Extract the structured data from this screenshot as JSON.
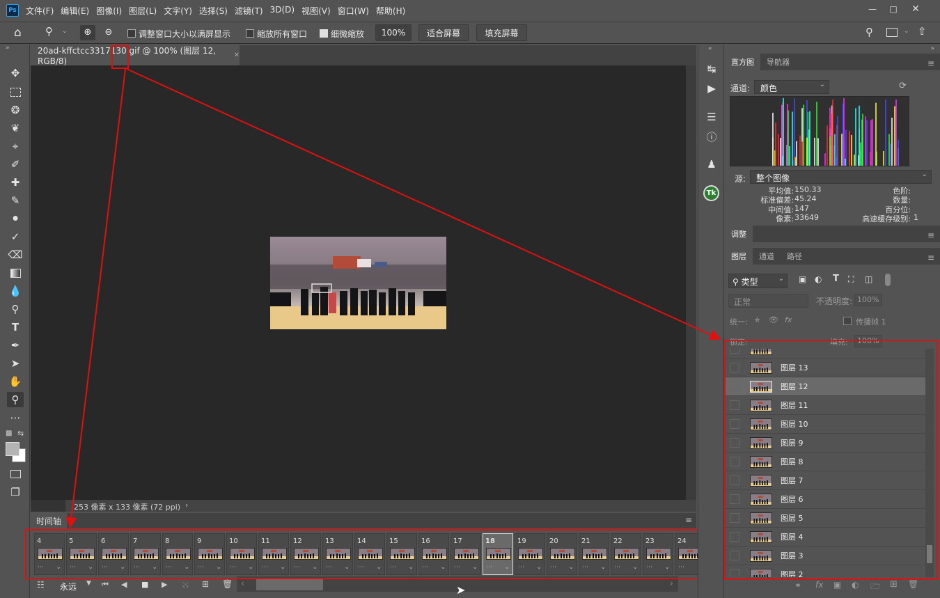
{
  "app": {
    "logo": "Ps",
    "menu": [
      "文件(F)",
      "编辑(E)",
      "图像(I)",
      "图层(L)",
      "文字(Y)",
      "选择(S)",
      "滤镜(T)",
      "3D(D)",
      "视图(V)",
      "窗口(W)",
      "帮助(H)"
    ]
  },
  "options": {
    "resize_windows": "调整窗口大小以满屏显示",
    "zoom_all": "缩放所有窗口",
    "scrubby_zoom": "细微缩放",
    "zoom_value": "100%",
    "fit_screen": "适合屏幕",
    "fill_screen": "填充屏幕"
  },
  "document": {
    "tab_title": "20ad-kffctcc3317130.gif @ 100% (图层 12, RGB/8)",
    "status": "253 像素 x 133 像素 (72 ppi)"
  },
  "timeline": {
    "title": "时间轴",
    "loop": "永远",
    "frames": [
      "4",
      "5",
      "6",
      "7",
      "8",
      "9",
      "10",
      "11",
      "12",
      "13",
      "14",
      "15",
      "16",
      "17",
      "18",
      "19",
      "20",
      "21",
      "22",
      "23",
      "24"
    ],
    "selected_frame": "18"
  },
  "histogram": {
    "tab": "直方图",
    "tab2": "导航器",
    "channel_label": "通道:",
    "channel": "颜色",
    "source_label": "源:",
    "source": "整个图像",
    "mean_label": "平均值:",
    "mean": "150.33",
    "std_label": "标准偏差:",
    "std": "45.24",
    "median_label": "中间值:",
    "median": "147",
    "pixels_label": "像素:",
    "pixels": "33649",
    "level_label": "色阶:",
    "count_label": "数量:",
    "percentile_label": "百分位:",
    "cache_label": "高速缓存级别:",
    "cache": "1"
  },
  "adjust": {
    "tab": "调整"
  },
  "layers_panel": {
    "tabs": [
      "图层",
      "通道",
      "路径"
    ],
    "filter": "类型",
    "blend": "正常",
    "opacity_label": "不透明度:",
    "opacity": "100%",
    "unify_label": "统一:",
    "propagate": "传播帧 1",
    "lock_label": "锁定:",
    "fill_label": "填充:",
    "fill": "100%",
    "layers": [
      "图层 13",
      "图层 12",
      "图层 11",
      "图层 10",
      "图层 9",
      "图层 8",
      "图层 7",
      "图层 6",
      "图层 5",
      "图层 4",
      "图层 3",
      "图层 2"
    ],
    "selected": "图层 12"
  },
  "colors": {
    "highlight": "#e01010",
    "panel": "#535353",
    "canvas": "#282828"
  }
}
